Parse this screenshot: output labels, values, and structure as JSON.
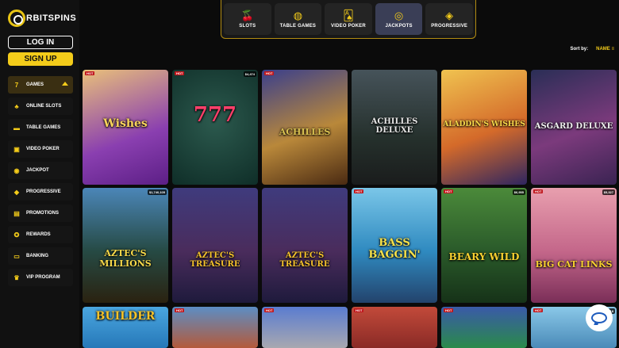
{
  "brand": {
    "logo_text": "RBITSPINS",
    "accent": "#f4cc1a"
  },
  "auth": {
    "login_label": "LOG IN",
    "signup_label": "SIGN UP"
  },
  "sidebar": {
    "items": [
      {
        "label": "GAMES",
        "icon": "seven-icon",
        "glyph": "7",
        "active": true
      },
      {
        "label": "ONLINE SLOTS",
        "icon": "slot-cherries-icon",
        "glyph": "♣"
      },
      {
        "label": "TABLE GAMES",
        "icon": "chips-icon",
        "glyph": "▬"
      },
      {
        "label": "VIDEO POKER",
        "icon": "cards-icon",
        "glyph": "▣"
      },
      {
        "label": "JACKPOT",
        "icon": "coin-icon",
        "glyph": "◉"
      },
      {
        "label": "PROGRESSIVE",
        "icon": "layers-icon",
        "glyph": "◆"
      },
      {
        "label": "PROMOTIONS",
        "icon": "gift-icon",
        "glyph": "▤"
      },
      {
        "label": "REWARDS",
        "icon": "medal-icon",
        "glyph": "✪"
      },
      {
        "label": "BANKING",
        "icon": "card-icon",
        "glyph": "▭"
      },
      {
        "label": "VIP PROGRAM",
        "icon": "crown-icon",
        "glyph": "♛"
      }
    ]
  },
  "tabs": [
    {
      "label": "SLOTS",
      "icon": "cherries-icon",
      "glyph": "🍒"
    },
    {
      "label": "TABLE GAMES",
      "icon": "chips-icon",
      "glyph": "◍"
    },
    {
      "label": "VIDEO POKER",
      "icon": "cards-icon",
      "glyph": "🂡"
    },
    {
      "label": "JACKPOTS",
      "icon": "jackpot-coin-icon",
      "glyph": "◎",
      "active": true
    },
    {
      "label": "PROGRESSIVE",
      "icon": "layers-icon",
      "glyph": "◈"
    }
  ],
  "sort": {
    "label": "Sort by:",
    "value": "NAME"
  },
  "games": [
    {
      "title": "Wishes",
      "badge": "HOT",
      "jackpot": ""
    },
    {
      "title": "777",
      "badge": "HOT",
      "jackpot": "$4,474"
    },
    {
      "title": "ACHILLES",
      "badge": "HOT",
      "jackpot": ""
    },
    {
      "title": "ACHILLES DELUXE",
      "badge": "",
      "jackpot": ""
    },
    {
      "title": "ALADDIN'S WISHES",
      "badge": "",
      "jackpot": ""
    },
    {
      "title": "ASGARD DELUXE",
      "badge": "",
      "jackpot": ""
    },
    {
      "title": "AZTEC'S MILLIONS",
      "badge": "",
      "jackpot": "$1,740,105"
    },
    {
      "title": "AZTEC'S TREASURE",
      "badge": "",
      "jackpot": ""
    },
    {
      "title": "AZTEC'S TREASURE",
      "badge": "",
      "jackpot": ""
    },
    {
      "title": "BASS BAGGIN'",
      "badge": "HOT",
      "jackpot": ""
    },
    {
      "title": "BEARY WILD",
      "badge": "HOT",
      "jackpot": "$6,955"
    },
    {
      "title": "BIG CAT LINKS",
      "badge": "HOT",
      "jackpot": "$5,327"
    },
    {
      "title": "BUILDER",
      "badge": "",
      "jackpot": ""
    },
    {
      "title": "",
      "badge": "HOT",
      "jackpot": ""
    },
    {
      "title": "",
      "badge": "HOT",
      "jackpot": ""
    },
    {
      "title": "",
      "badge": "HOT",
      "jackpot": ""
    },
    {
      "title": "",
      "badge": "HOT",
      "jackpot": ""
    },
    {
      "title": "",
      "badge": "HOT",
      "jackpot": "$4,918"
    },
    {
      "title": "",
      "badge": "",
      "jackpot": ""
    }
  ]
}
